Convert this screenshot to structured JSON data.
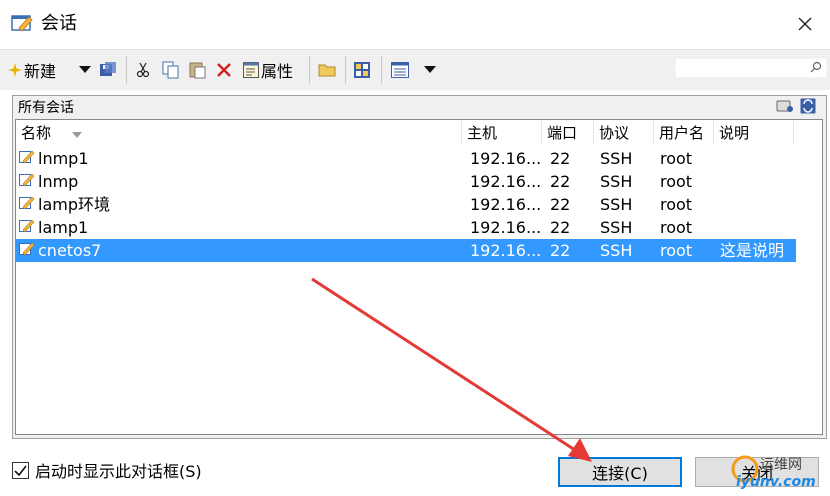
{
  "window": {
    "title": "会话",
    "close_glyph": "✕"
  },
  "toolbar": {
    "new_label": "新建",
    "properties_label": "属性",
    "search_placeholder": ""
  },
  "panel": {
    "heading": "所有会话"
  },
  "columns": [
    "名称",
    "主机",
    "端口",
    "协议",
    "用户名",
    "说明"
  ],
  "sessions": [
    {
      "name": "lnmp1",
      "host": "192.16...",
      "port": "22",
      "protocol": "SSH",
      "user": "root",
      "desc": ""
    },
    {
      "name": "lnmp",
      "host": "192.16...",
      "port": "22",
      "protocol": "SSH",
      "user": "root",
      "desc": ""
    },
    {
      "name": "lamp环境",
      "host": "192.16...",
      "port": "22",
      "protocol": "SSH",
      "user": "root",
      "desc": ""
    },
    {
      "name": "lamp1",
      "host": "192.16...",
      "port": "22",
      "protocol": "SSH",
      "user": "root",
      "desc": ""
    },
    {
      "name": "cnetos7",
      "host": "192.16...",
      "port": "22",
      "protocol": "SSH",
      "user": "root",
      "desc": "这是说明"
    }
  ],
  "selected_index": 4,
  "footer": {
    "startup_checkbox_label": "启动时显示此对话框(S)",
    "startup_checked": true,
    "connect_label": "连接(C)",
    "close_label": "关闭"
  },
  "watermark": {
    "line1": "运维网",
    "line2": "iyunv.com"
  },
  "colors": {
    "selection": "#3399ff",
    "arrow": "#e53935",
    "accent": "#0078d7"
  }
}
